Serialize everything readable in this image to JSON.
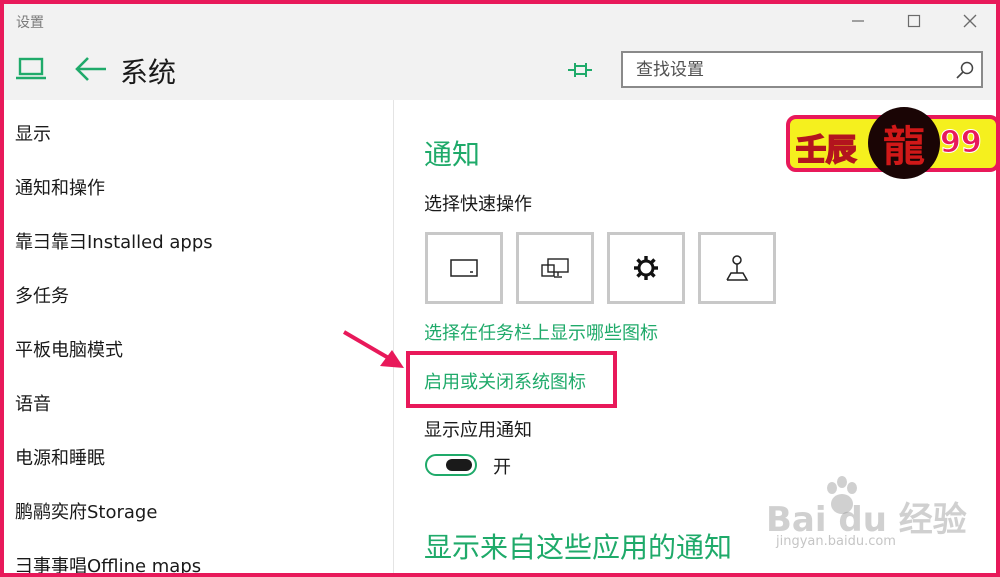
{
  "window": {
    "title": "设置"
  },
  "header": {
    "title": "系统",
    "search_placeholder": "查找设置"
  },
  "sidebar": {
    "items": [
      {
        "label": "显示"
      },
      {
        "label": "通知和操作"
      },
      {
        "label": "靠彐靠彐Installed apps"
      },
      {
        "label": "多任务"
      },
      {
        "label": "平板电脑模式"
      },
      {
        "label": "语音"
      },
      {
        "label": "电源和睡眠"
      },
      {
        "label": "鹏鹝奕府Storage"
      },
      {
        "label": "彐事事唱Offline maps"
      }
    ]
  },
  "main": {
    "section_title": "通知",
    "quick_actions_label": "选择快速操作",
    "quick_action_icons": [
      "tablet-mode-icon",
      "project-display-icon",
      "gear-icon",
      "location-pin-icon"
    ],
    "taskbar_icons_link": "选择在任务栏上显示哪些图标",
    "system_icons_link": "启用或关闭系统图标",
    "app_notifications_label": "显示应用通知",
    "app_notifications_toggle": "开",
    "apps_section_title": "显示来自这些应用的通知"
  },
  "watermark": {
    "badge_text": "壬辰",
    "badge_glyph": "龍",
    "badge_number": "99",
    "logo_text": "Bai du 经验",
    "site": "jingyan.baidu.com"
  },
  "colors": {
    "accent": "#1faa6a",
    "annotation": "#e8195a",
    "chrome": "#f2f2f2"
  }
}
